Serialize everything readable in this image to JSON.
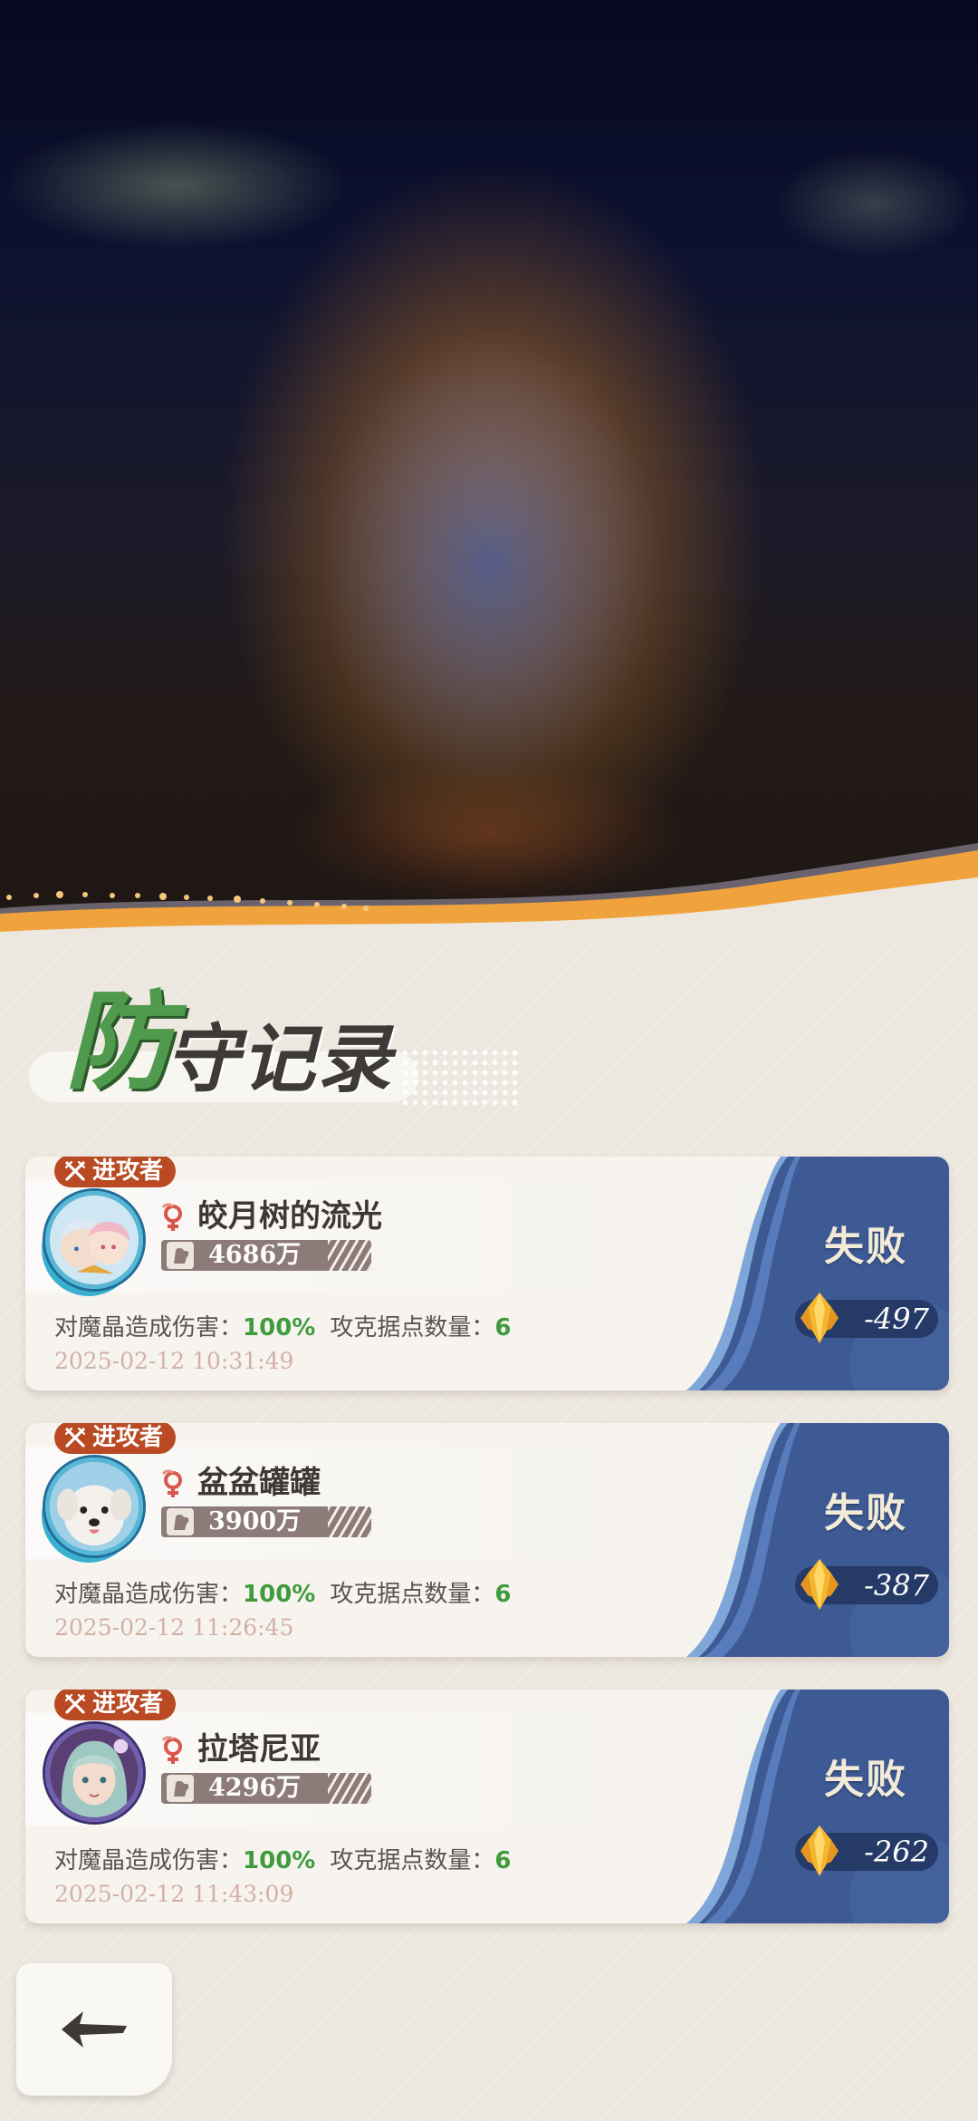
{
  "page": {
    "title_first_char": "防",
    "title_rest": "守记录"
  },
  "records": [
    {
      "tag": "进攻者",
      "name": "皎月树的流光",
      "power": "4686万",
      "damage_label": "对魔晶造成伤害：",
      "damage_value": "100%",
      "captured_label": "攻克据点数量：",
      "captured_value": "6",
      "timestamp": "2025-02-12 10:31:49",
      "result": "失败",
      "score": "-497",
      "avatar": "anime-duo-avatar"
    },
    {
      "tag": "进攻者",
      "name": "盆盆罐罐",
      "power": "3900万",
      "damage_label": "对魔晶造成伤害：",
      "damage_value": "100%",
      "captured_label": "攻克据点数量：",
      "captured_value": "6",
      "timestamp": "2025-02-12 11:26:45",
      "result": "失败",
      "score": "-387",
      "avatar": "white-dog-avatar"
    },
    {
      "tag": "进攻者",
      "name": "拉塔尼亚",
      "power": "4296万",
      "damage_label": "对魔晶造成伤害：",
      "damage_value": "100%",
      "captured_label": "攻克据点数量：",
      "captured_value": "6",
      "timestamp": "2025-02-12 11:43:09",
      "result": "失败",
      "score": "-262",
      "avatar": "anime-girl-avatar"
    }
  ],
  "icons": {
    "back": "back-arrow-icon",
    "tag": "crossed-swords-icon",
    "gender": "female-icon",
    "power": "fist-icon",
    "score": "crystal-icon"
  },
  "colors": {
    "accent_green": "#3f9b3e",
    "tag_red": "#b94a23",
    "result_blue": "#3d5a94",
    "orange_wave": "#f0a23c"
  }
}
